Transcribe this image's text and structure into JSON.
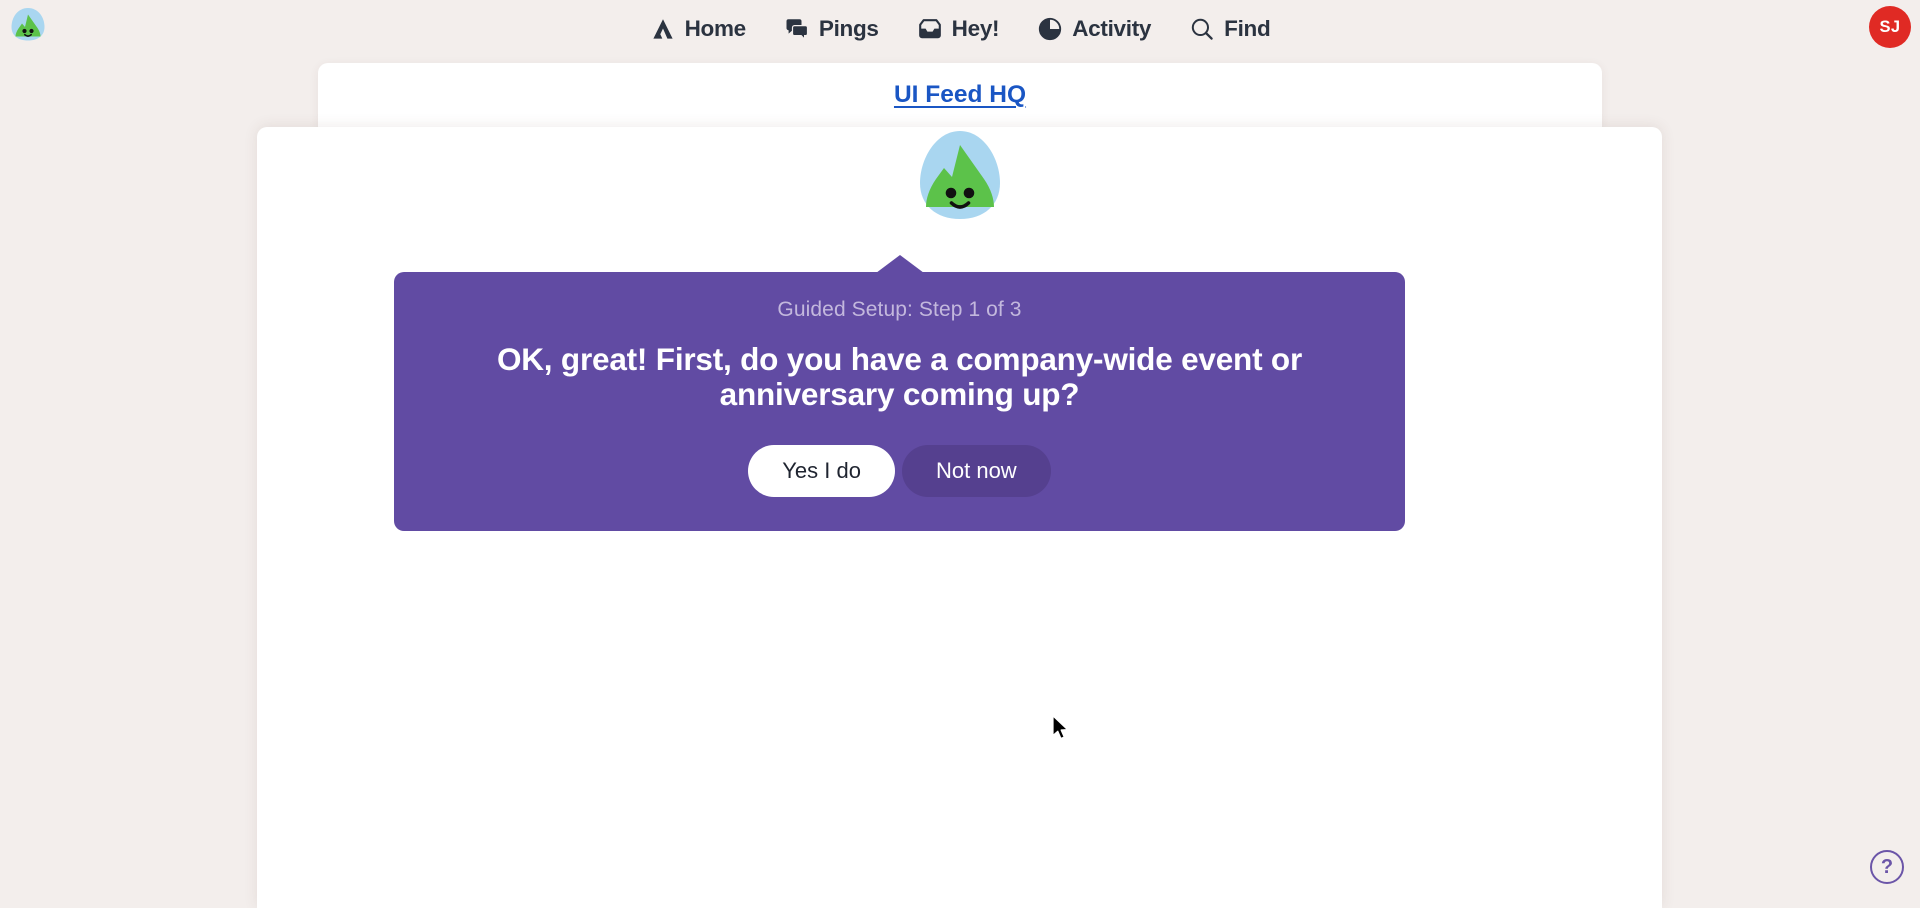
{
  "topbar": {
    "logo": {
      "name": "app-logo",
      "icon": "mountain-mascot-icon",
      "colors": {
        "hill": "#5cc24a",
        "dome": "#a9d6f0"
      }
    },
    "nav": [
      {
        "label": "Home",
        "icon": "home-tent-icon"
      },
      {
        "label": "Pings",
        "icon": "speech-bubbles-icon"
      },
      {
        "label": "Hey!",
        "icon": "inbox-tray-icon"
      },
      {
        "label": "Activity",
        "icon": "pie-chart-icon"
      },
      {
        "label": "Find",
        "icon": "magnifying-glass-icon"
      }
    ],
    "avatar": {
      "initials": "SJ",
      "color": "#e02a24"
    }
  },
  "back_card": {
    "link_label": "UI Feed HQ",
    "link_color": "#1a56c4"
  },
  "guided_setup": {
    "step_label": "Guided Setup: Step 1 of 3",
    "question": "OK, great! First, do you have a company-wide event or anniversary coming up?",
    "panel_color": "#614ba3",
    "buttons": {
      "primary": "Yes I do",
      "secondary": "Not now"
    }
  },
  "help": {
    "label": "?",
    "color": "#6b55a8"
  },
  "colors": {
    "page_background": "#f3eeec",
    "card_background": "#ffffff",
    "nav_text": "#2b3340"
  }
}
